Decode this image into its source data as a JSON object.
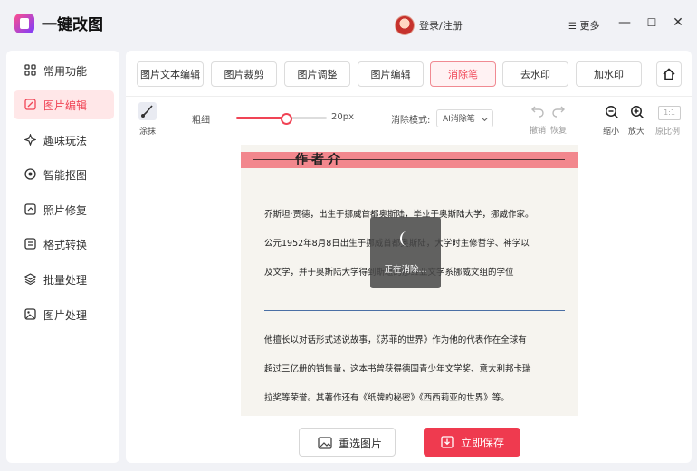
{
  "app": {
    "title": "一键改图",
    "login": "登录/注册",
    "more": "更多"
  },
  "window": {
    "menu_glyph": "☰",
    "minimize": "—",
    "maximize": "☐",
    "close": "✕"
  },
  "sidebar": {
    "items": [
      {
        "label": "常用功能",
        "icon": "grid-icon",
        "active": false
      },
      {
        "label": "图片编辑",
        "icon": "edit-icon",
        "active": true
      },
      {
        "label": "趣味玩法",
        "icon": "fun-icon",
        "active": false
      },
      {
        "label": "智能抠图",
        "icon": "target-icon",
        "active": false
      },
      {
        "label": "照片修复",
        "icon": "repair-icon",
        "active": false
      },
      {
        "label": "格式转换",
        "icon": "convert-icon",
        "active": false
      },
      {
        "label": "批量处理",
        "icon": "layers-icon",
        "active": false
      },
      {
        "label": "图片处理",
        "icon": "image-icon",
        "active": false
      }
    ]
  },
  "tabs": [
    {
      "label": "图片文本编辑",
      "active": false
    },
    {
      "label": "图片裁剪",
      "active": false
    },
    {
      "label": "图片调整",
      "active": false
    },
    {
      "label": "图片编辑",
      "active": false
    },
    {
      "label": "消除笔",
      "active": true
    },
    {
      "label": "去水印",
      "active": false
    },
    {
      "label": "加水印",
      "active": false
    }
  ],
  "toolbar": {
    "smear_label": "涂抹",
    "thickness_label": "粗细",
    "thickness_value": "20px",
    "thickness_fraction": 0.55,
    "erase_mode_label": "消除模式:",
    "erase_mode_value": "AI消除笔",
    "undo_label": "撤销",
    "redo_label": "恢复",
    "zoom_out_label": "缩小",
    "zoom_in_label": "放大",
    "ratio_box": "1:1",
    "ratio_label": "原比例"
  },
  "canvas": {
    "heading": "作者介",
    "lines": [
      "乔斯坦·贾德，出生于挪威首都奥斯陆，毕业于奥斯陆大学，挪威作家。",
      "公元1952年8月8日出生于挪威首都奥斯陆，大学时主修哲学、神学以",
      "及文学，并于奥斯陆大学得到斯堪的那维亚文学系挪威文组的学位",
      "他擅长以对话形式述说故事，《苏菲的世界》作为他的代表作在全球有",
      "超过三亿册的销售量，这本书曾获得德国青少年文学奖、意大利邦卡瑞",
      "拉奖等荣誉。其著作还有《纸牌的秘密》《西西莉亚的世界》等。"
    ]
  },
  "overlay": {
    "text": "正在消除..."
  },
  "buttons": {
    "reselect": "重选图片",
    "save": "立即保存"
  },
  "colors": {
    "accent": "#ef3a4f",
    "active_bg": "#ffe7e8"
  }
}
